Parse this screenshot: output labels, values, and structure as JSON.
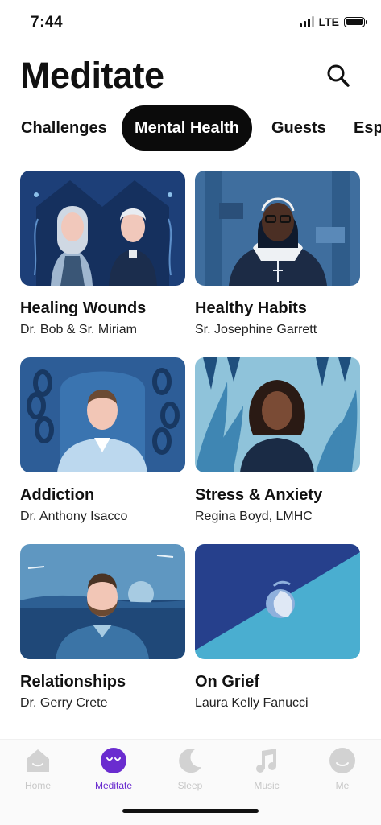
{
  "status": {
    "time": "7:44",
    "network": "LTE"
  },
  "header": {
    "title": "Meditate"
  },
  "tabs": [
    {
      "label": "Challenges"
    },
    {
      "label": "Mental Health"
    },
    {
      "label": "Guests"
    },
    {
      "label": "Esp"
    }
  ],
  "cards": [
    {
      "title": "Healing Wounds",
      "subtitle": "Dr. Bob & Sr. Miriam"
    },
    {
      "title": "Healthy Habits",
      "subtitle": "Sr. Josephine Garrett"
    },
    {
      "title": "Addiction",
      "subtitle": "Dr. Anthony Isacco"
    },
    {
      "title": "Stress & Anxiety",
      "subtitle": "Regina Boyd, LMHC"
    },
    {
      "title": "Relationships",
      "subtitle": "Dr. Gerry Crete"
    },
    {
      "title": "On Grief",
      "subtitle": "Laura Kelly Fanucci"
    }
  ],
  "tabbar": {
    "items": [
      {
        "label": "Home",
        "icon": "home-icon",
        "active": false
      },
      {
        "label": "Meditate",
        "icon": "meditate-face-icon",
        "active": true
      },
      {
        "label": "Sleep",
        "icon": "moon-icon",
        "active": false
      },
      {
        "label": "Music",
        "icon": "music-note-icon",
        "active": false
      },
      {
        "label": "Me",
        "icon": "profile-icon",
        "active": false
      }
    ]
  },
  "colors": {
    "accent": "#6a2ccf",
    "inactive": "#c7c7c7",
    "navy": "#1b3a6e",
    "teal": "#4aaed0"
  }
}
